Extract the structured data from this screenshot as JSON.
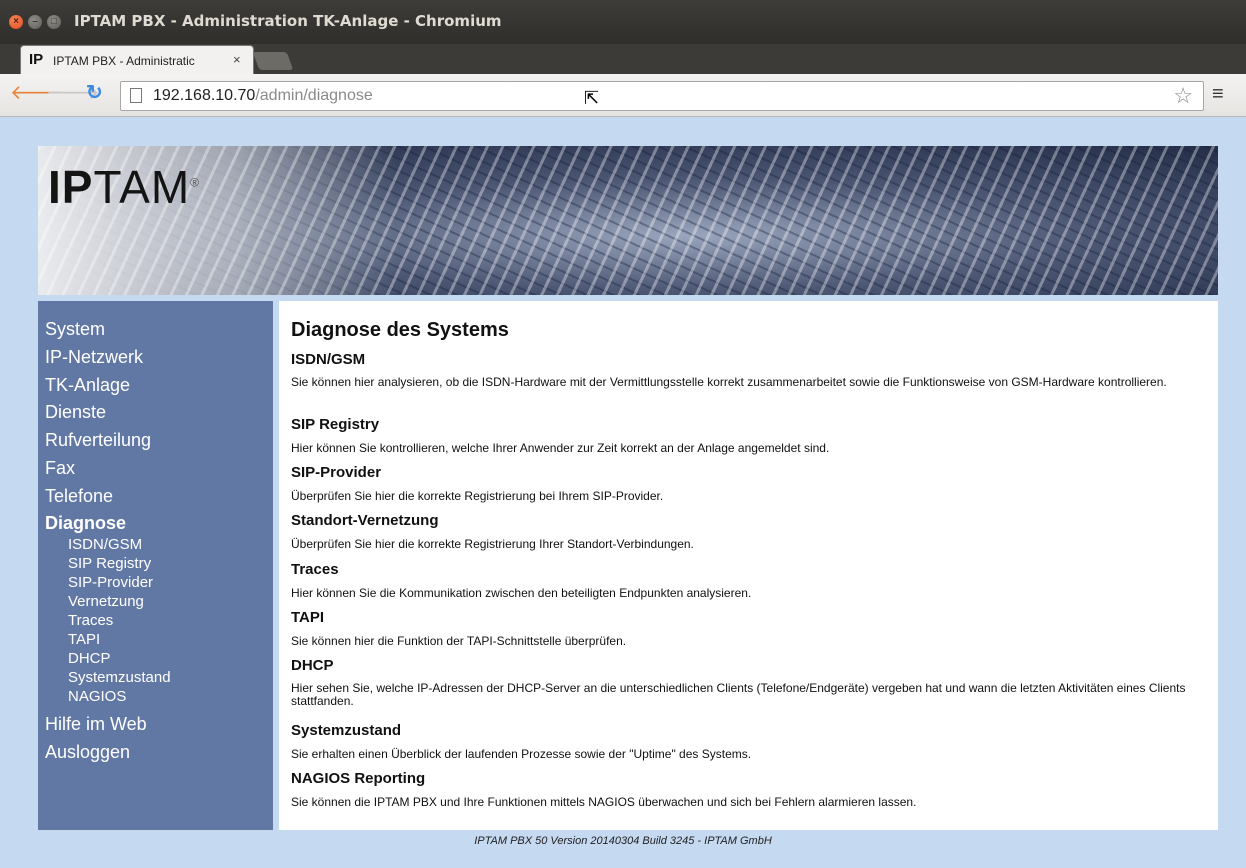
{
  "window": {
    "title": "IPTAM PBX - Administration TK-Anlage - Chromium"
  },
  "tab": {
    "favicon_text": "IP",
    "label": "IPTAM PBX - Administratic",
    "close": "×"
  },
  "toolbar": {
    "url_host": "192.168.10.70",
    "url_path": "/admin/diagnose"
  },
  "icons": {
    "back": "arrow-left",
    "forward": "arrow-right",
    "reload": "reload",
    "star": "star",
    "menu": "hamburger"
  },
  "banner": {
    "logo_bold": "IP",
    "logo_rest": "TAM",
    "logo_reg": "®"
  },
  "sidebar": {
    "items": [
      {
        "label": "System"
      },
      {
        "label": "IP-Netzwerk"
      },
      {
        "label": "TK-Anlage"
      },
      {
        "label": "Dienste"
      },
      {
        "label": "Rufverteilung"
      },
      {
        "label": "Fax"
      },
      {
        "label": "Telefone"
      },
      {
        "label": "Diagnose",
        "active": true
      }
    ],
    "subitems": [
      {
        "label": "ISDN/GSM"
      },
      {
        "label": "SIP Registry"
      },
      {
        "label": "SIP-Provider"
      },
      {
        "label": "Vernetzung"
      },
      {
        "label": "Traces"
      },
      {
        "label": "TAPI"
      },
      {
        "label": "DHCP"
      },
      {
        "label": "Systemzustand"
      },
      {
        "label": "NAGIOS"
      }
    ],
    "bottom_items": [
      {
        "label": "Hilfe im Web"
      },
      {
        "label": "Ausloggen"
      }
    ]
  },
  "main": {
    "title": "Diagnose des Systems",
    "sections": [
      {
        "title": "ISDN/GSM",
        "text": "Sie können hier analysieren, ob die ISDN-Hardware mit der Vermittlungsstelle korrekt zusammenarbeitet sowie die Funktionsweise von GSM-Hardware kontrollieren."
      },
      {
        "title": "SIP Registry",
        "text": "Hier können Sie kontrollieren, welche Ihrer Anwender zur Zeit korrekt an der Anlage angemeldet sind."
      },
      {
        "title": "SIP-Provider",
        "text": "Überprüfen Sie hier die korrekte Registrierung bei Ihrem SIP-Provider."
      },
      {
        "title": "Standort-Vernetzung",
        "text": "Überprüfen Sie hier die korrekte Registrierung Ihrer Standort-Verbindungen."
      },
      {
        "title": "Traces",
        "text": "Hier können Sie die Kommunikation zwischen den beteiligten Endpunkten analysieren."
      },
      {
        "title": "TAPI",
        "text": "Sie können hier die Funktion der TAPI-Schnittstelle überprüfen."
      },
      {
        "title": "DHCP",
        "text": "Hier sehen Sie, welche IP-Adressen der DHCP-Server an die unterschiedlichen Clients (Telefone/Endgeräte) vergeben hat und wann die letzten Aktivitäten eines Clients stattfanden."
      },
      {
        "title": "Systemzustand",
        "text": "Sie erhalten einen Überblick der laufenden Prozesse sowie der \"Uptime\" des Systems."
      },
      {
        "title": "NAGIOS Reporting",
        "text": "Sie können die IPTAM PBX und Ihre Funktionen mittels NAGIOS überwachen und sich bei Fehlern alarmieren lassen."
      }
    ]
  },
  "footer": {
    "text": "IPTAM PBX 50 Version 20140304 Build 3245 - IPTAM GmbH"
  }
}
